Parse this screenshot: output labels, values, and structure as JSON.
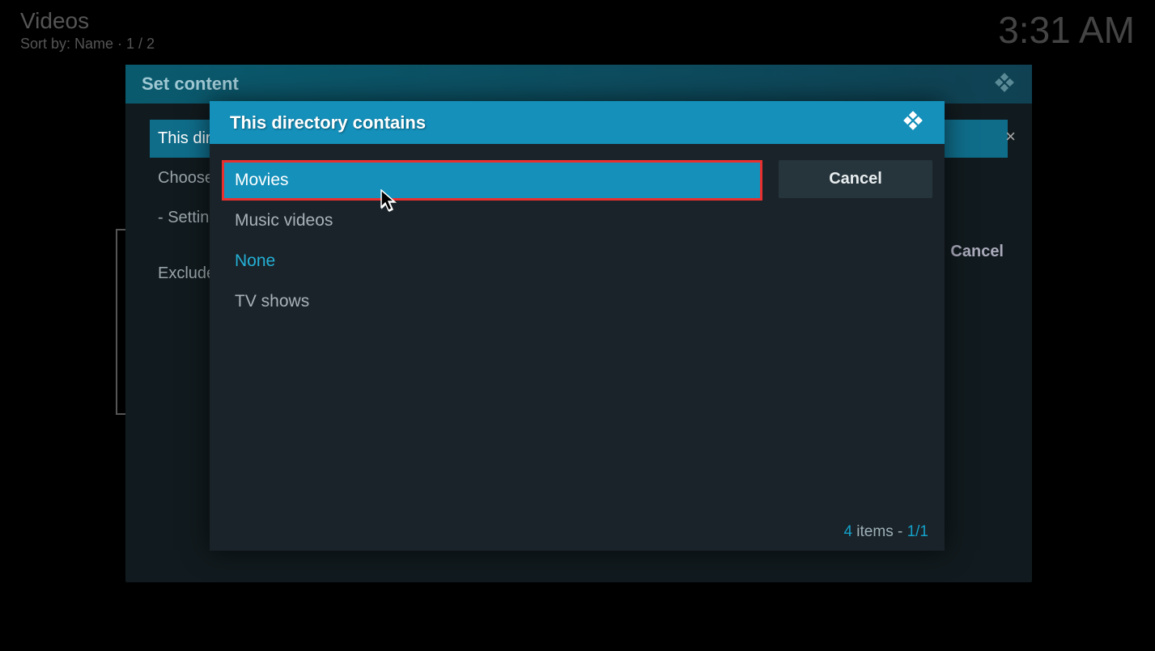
{
  "header": {
    "title": "Videos",
    "sort_label": "Sort by: Name  ·  1 / 2",
    "clock": "3:31 AM"
  },
  "outer_dialog": {
    "title": "Set content",
    "rows": [
      "This directory contains",
      "Choose information provider",
      "- Settings"
    ],
    "exclude_row": "Exclude path from library updates",
    "close": "×",
    "cancel": "Cancel"
  },
  "inner_dialog": {
    "title": "This directory contains",
    "items": [
      {
        "label": "Movies",
        "type": "highlighted"
      },
      {
        "label": "Music videos",
        "type": "normal"
      },
      {
        "label": "None",
        "type": "current"
      },
      {
        "label": "TV shows",
        "type": "normal"
      }
    ],
    "cancel_button": "Cancel",
    "status_count": "4",
    "status_items_word": " items - ",
    "status_page": "1/1"
  }
}
